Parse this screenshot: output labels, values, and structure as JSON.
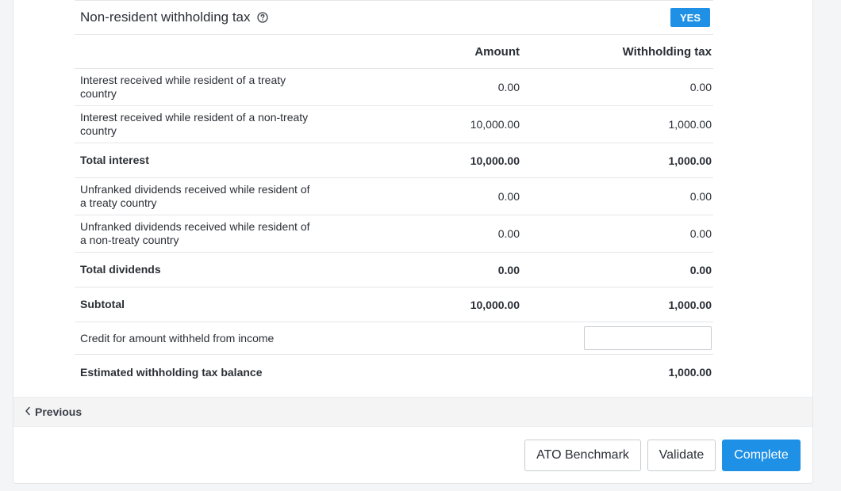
{
  "section": {
    "title": "Non-resident withholding tax",
    "help_icon": "question-circle-icon",
    "badge": "YES"
  },
  "table": {
    "headers": {
      "amount": "Amount",
      "withholding": "Withholding tax"
    },
    "rows": [
      {
        "label": "Interest received while resident of a treaty country",
        "amount": "0.00",
        "withholding": "0.00"
      },
      {
        "label": "Interest received while resident of a non-treaty country",
        "amount": "10,000.00",
        "withholding": "1,000.00"
      },
      {
        "label": "Total interest",
        "amount": "10,000.00",
        "withholding": "1,000.00"
      },
      {
        "label": "Unfranked dividends received while resident of a treaty country",
        "amount": "0.00",
        "withholding": "0.00"
      },
      {
        "label": "Unfranked dividends received while resident of a non-treaty country",
        "amount": "0.00",
        "withholding": "0.00"
      },
      {
        "label": "Total dividends",
        "amount": "0.00",
        "withholding": "0.00"
      },
      {
        "label": "Subtotal",
        "amount": "10,000.00",
        "withholding": "1,000.00"
      }
    ],
    "credit": {
      "label": "Credit for amount withheld from income",
      "value": ""
    },
    "balance": {
      "label": "Estimated withholding tax balance",
      "withholding": "1,000.00"
    }
  },
  "nav": {
    "previous_label": "Previous",
    "previous_icon": "chevron-left-icon"
  },
  "footer": {
    "ato_benchmark": "ATO Benchmark",
    "validate": "Validate",
    "complete": "Complete"
  },
  "colors": {
    "primary": "#1e90e6",
    "border": "#e4e6ea",
    "text": "#2b2f36"
  }
}
